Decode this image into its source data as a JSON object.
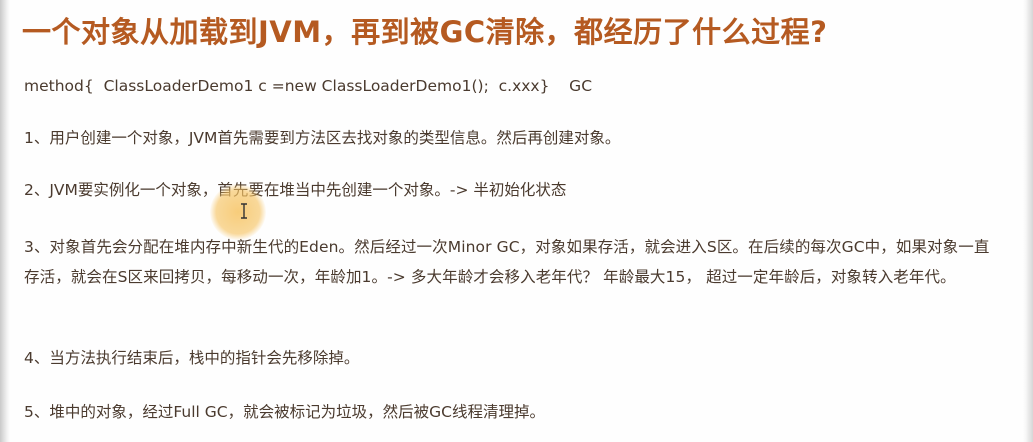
{
  "title": "一个对象从加载到JVM，再到被GC清除，都经历了什么过程?",
  "code_line": "method{  ClassLoaderDemo1 c =new ClassLoaderDemo1();  c.xxx}    GC",
  "steps": [
    "1、用户创建一个对象，JVM首先需要到方法区去找对象的类型信息。然后再创建对象。",
    "2、JVM要实例化一个对象，首先要在堆当中先创建一个对象。-> 半初始化状态",
    "3、对象首先会分配在堆内存中新生代的Eden。然后经过一次Minor GC，对象如果存活，就会进入S区。在后续的每次GC中，如果对象一直存活，就会在S区来回拷贝，每移动一次，年龄加1。-> 多大年龄才会移入老年代？  年龄最大15，  超过一定年龄后，对象转入老年代。",
    "4、当方法执行结束后，栈中的指针会先移除掉。",
    "5、堆中的对象，经过Full GC，就会被标记为垃圾，然后被GC线程清理掉。"
  ],
  "colors": {
    "title": "#b55a21",
    "body_text": "#4a3a2e",
    "cursor_highlight": "#f6c464"
  },
  "icons": {
    "cursor": "i-beam-cursor-icon"
  }
}
